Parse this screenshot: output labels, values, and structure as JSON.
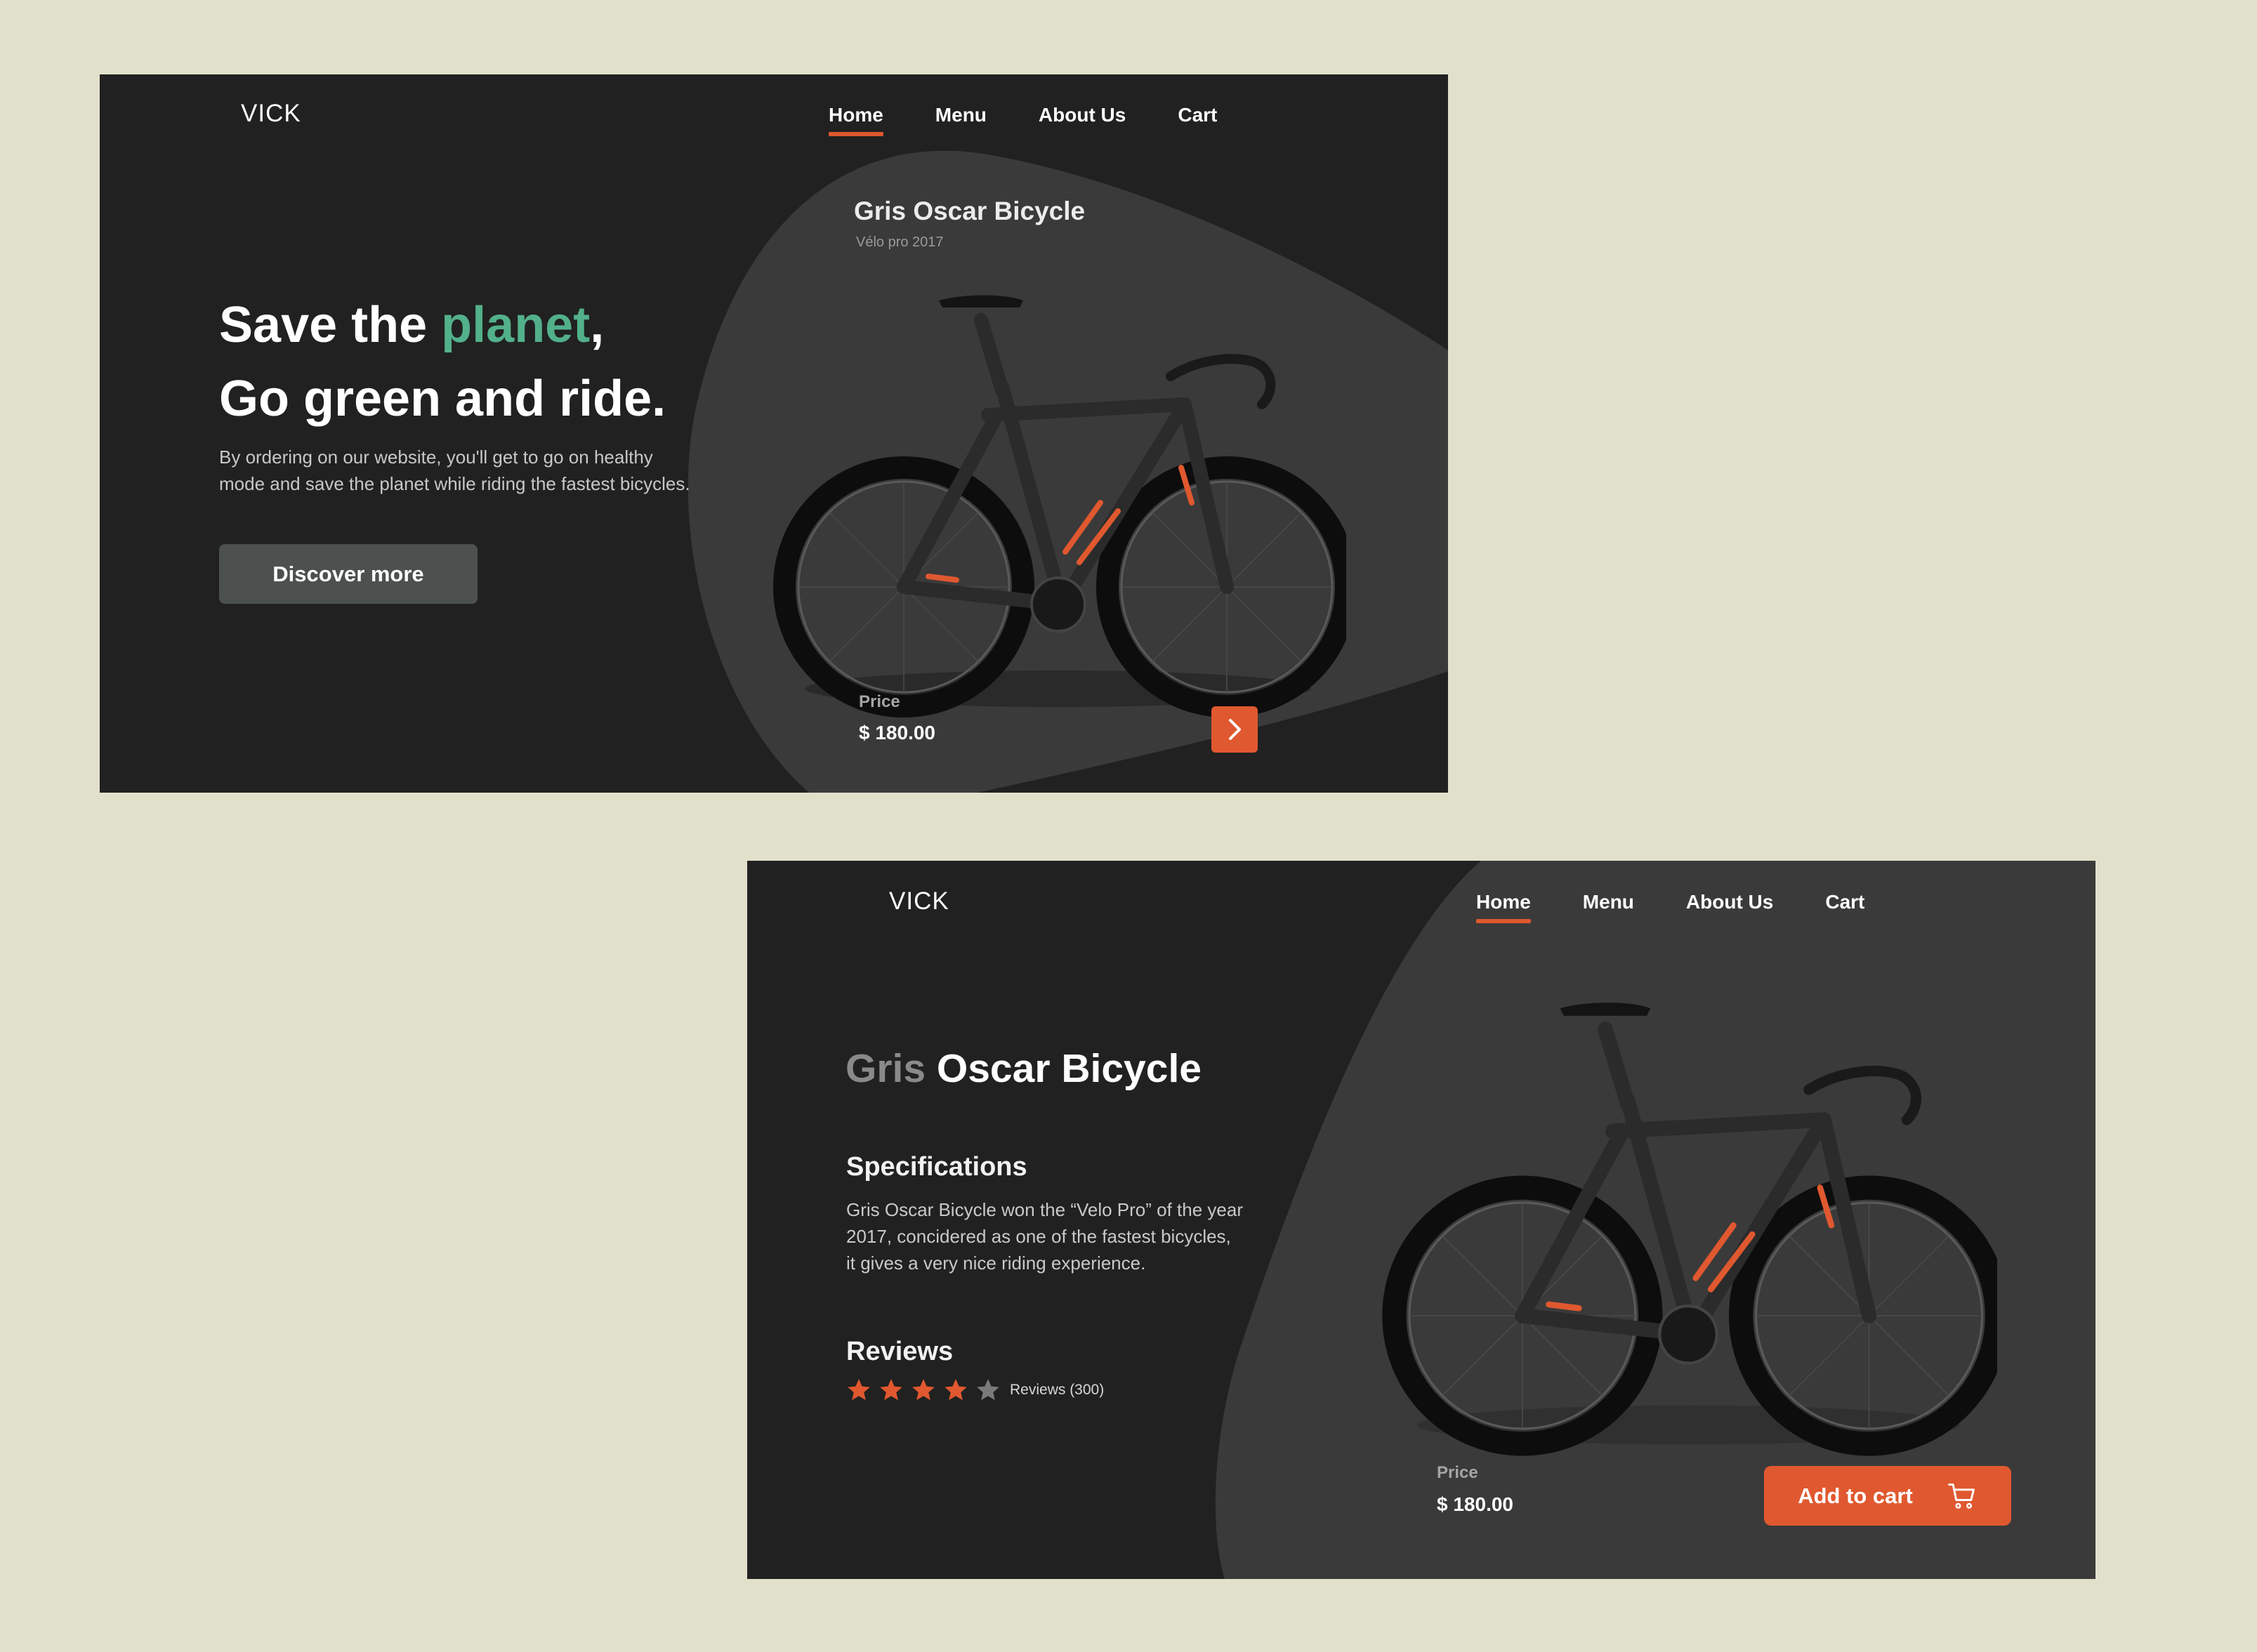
{
  "colors": {
    "canvas_bg": "#e1e0cb",
    "frame_bg": "#212121",
    "blob_bg": "#3a3a3a",
    "accent_orange": "#e0582f",
    "accent_green": "#52b08a",
    "button_gray": "#4c504e"
  },
  "screen1": {
    "logo": "VICK",
    "nav": [
      "Home",
      "Menu",
      "About Us",
      "Cart"
    ],
    "active_nav": "Home",
    "hero": {
      "line1_start": "Save the ",
      "line1_accent": "planet",
      "line1_end": ",",
      "line2": "Go green and ride.",
      "description": "By ordering on our website, you'll get to go on healthy mode and save the planet while riding the fastest bicycles.",
      "cta": "Discover more"
    },
    "card": {
      "title": "Gris Oscar Bicycle",
      "subtitle": "Vélo pro 2017",
      "price_label": "Price",
      "price": "$ 180.00",
      "next_icon": "chevron-right-icon"
    }
  },
  "screen2": {
    "logo": "VICK",
    "nav": [
      "Home",
      "Menu",
      "About Us",
      "Cart"
    ],
    "active_nav": "Home",
    "product": {
      "title_muted": "Gris",
      "title_rest": " Oscar Bicycle",
      "spec_heading": "Specifications",
      "spec_text": "Gris Oscar Bicycle won the “Velo Pro” of the year 2017, concidered as one of the fastest bicycles, it gives a very nice riding experience.",
      "reviews_heading": "Reviews",
      "rating": 4,
      "rating_max": 5,
      "reviews_count": "Reviews (300)",
      "price_label": "Price",
      "price": "$ 180.00",
      "cart_button": "Add to cart",
      "cart_icon": "shopping-cart-icon"
    }
  }
}
